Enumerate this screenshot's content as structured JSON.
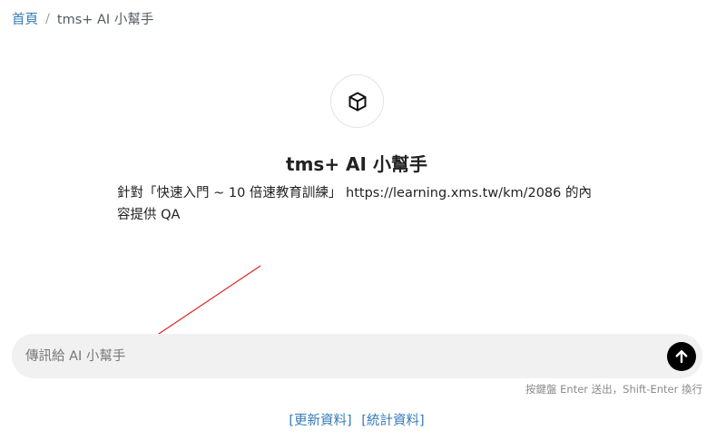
{
  "breadcrumb": {
    "home": "首頁",
    "separator": "/",
    "current": "tms+ AI 小幫手"
  },
  "assistant": {
    "logo_icon": "cube-icon",
    "title": "tms+ AI 小幫手",
    "description": "針對「快速入門 ~ 10 倍速教育訓練」 https://learning.xms.tw/km/2086 的內容提供 QA"
  },
  "composer": {
    "placeholder": "傳訊給 AI 小幫手",
    "value": "",
    "send_icon": "arrow-up-icon"
  },
  "hint": "按鍵盤 Enter 送出，Shift-Enter 換行",
  "footer": {
    "update_link": "[更新資料]",
    "stats_link": "[統計資料]"
  },
  "colors": {
    "link": "#337ab7",
    "composer_bg": "#f1f1f1",
    "send_button": "#000000",
    "annotation_arrow": "#e02020"
  }
}
